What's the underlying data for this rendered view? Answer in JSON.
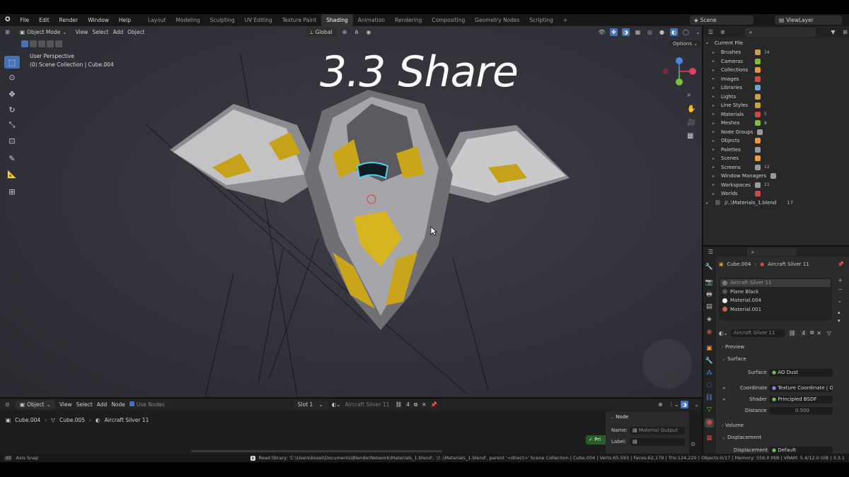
{
  "topbar": {
    "menus": [
      "File",
      "Edit",
      "Render",
      "Window",
      "Help"
    ],
    "workspaces": [
      "Layout",
      "Modeling",
      "Sculpting",
      "UV Editing",
      "Texture Paint",
      "Shading",
      "Animation",
      "Rendering",
      "Compositing",
      "Geometry Nodes",
      "Scripting"
    ],
    "active_workspace": "Shading",
    "scene": "Scene",
    "view_layer": "ViewLayer"
  },
  "viewport": {
    "mode": "Object Mode",
    "menus": [
      "View",
      "Select",
      "Add",
      "Object"
    ],
    "orientation": "Global",
    "options": "Options",
    "info_line1": "User Perspective",
    "info_line2": "(0) Scene Collection | Cube.004",
    "overlay_title": "3.3 Share"
  },
  "outliner": {
    "root": "Current File",
    "items": [
      {
        "label": "Brushes",
        "badge": "34"
      },
      {
        "label": "Cameras",
        "badge": ""
      },
      {
        "label": "Collections",
        "badge": ""
      },
      {
        "label": "Images",
        "badge": ""
      },
      {
        "label": "Libraries",
        "badge": ""
      },
      {
        "label": "Lights",
        "badge": ""
      },
      {
        "label": "Line Styles",
        "badge": ""
      },
      {
        "label": "Materials",
        "badge": "5"
      },
      {
        "label": "Meshes",
        "badge": "8"
      },
      {
        "label": "Node Groups",
        "badge": ""
      },
      {
        "label": "Objects",
        "badge": ""
      },
      {
        "label": "Palettes",
        "badge": ""
      },
      {
        "label": "Scenes",
        "badge": ""
      },
      {
        "label": "Screens",
        "badge": "12"
      },
      {
        "label": "Window Managers",
        "badge": ""
      },
      {
        "label": "Workspaces",
        "badge": "11"
      },
      {
        "label": "Worlds",
        "badge": ""
      }
    ],
    "library": "//..\\Materials_1.blend",
    "library_badge": "17"
  },
  "properties": {
    "breadcrumb_object": "Cube.004",
    "breadcrumb_material": "Aircraft Silver 11",
    "slots": [
      "Aircraft Silver 11",
      "Plane Black",
      "Material.004",
      "Material.001"
    ],
    "material_name": "Aircraft Silver 11",
    "users": "4",
    "sections": {
      "preview": "Preview",
      "surface": "Surface",
      "volume": "Volume",
      "displacement": "Displacement"
    },
    "surface_label": "Surface",
    "surface_value": "AO Dust",
    "coordinate_label": "Coordinate",
    "coordinate_value": "Texture Coordinate | Ob...",
    "shader_label": "Shader",
    "shader_value": "Principled BSDF",
    "distance_label": "Distance",
    "distance_value": "0.500",
    "displacement_label": "Displacement",
    "displacement_value": "Default"
  },
  "node_editor": {
    "type": "Object",
    "menus": [
      "View",
      "Select",
      "Add",
      "Node"
    ],
    "use_nodes": "Use Nodes",
    "slot": "Slot 1",
    "material": "Aircraft Silver 11",
    "users": "4",
    "breadcrumb": [
      "Cube.004",
      "Cube.005",
      "Aircraft Silver 11"
    ],
    "node_panel_title": "Node",
    "name_label": "Name:",
    "name_value": "Material Output",
    "label_label": "Label:",
    "partial_node": "Pri"
  },
  "statusbar": {
    "left": "Axis Snap",
    "message": "Read library:  'C:\\Users\\kosei\\Documents\\BlenderNetwork\\Materials_1.blend', '//..\\Materials_1.blend', parent '<direct>'",
    "stats": "Scene Collection | Cube.004 | Verts:65,593 | Faces:62,179 | Tris:124,220 | Objects:0/17 | Memory: 556.0 MiB | VRAM: 5.4/12.0 GiB | 3.3.1"
  }
}
